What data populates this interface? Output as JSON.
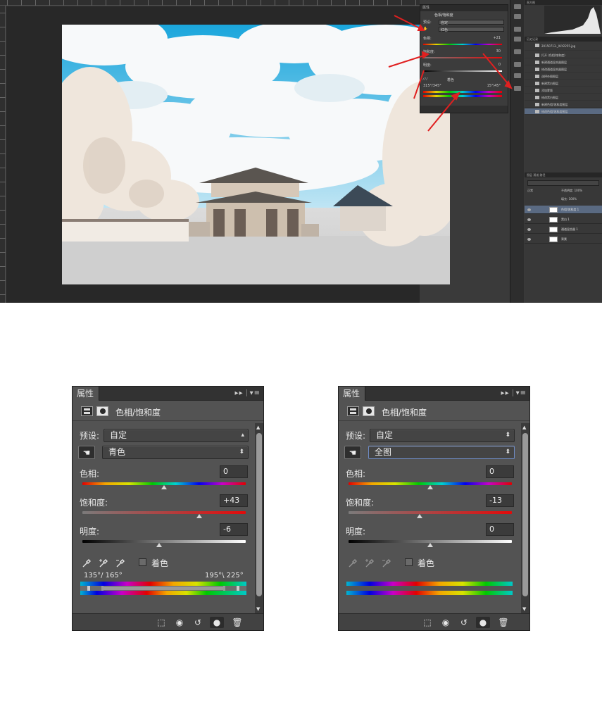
{
  "top": {
    "props_tab": "属性",
    "props_title": "色相/饱和度",
    "preset_label": "预设:",
    "preset_value": "自定",
    "channel_value": "红色",
    "hue_label": "色相:",
    "hue_value": "+21",
    "sat_label": "饱和度:",
    "sat_value": "30",
    "light_label": "明度:",
    "light_value": "0",
    "range_left": "315°/345°",
    "range_right": "15°\\45°",
    "colorize_label": "着色",
    "histo_tab": "直方图",
    "history_tabs": "历史记录",
    "history_doc": "20150713-_XLY2255.jpg",
    "history_items": [
      "打开 (色相/饱和度)",
      "新建通道混合器图层",
      "修改通道混合器图层",
      "选择杂图图层",
      "新建黑白图层",
      "添加蒙版",
      "修改黑白图层",
      "新建色相/饱和度图层",
      "修改色相/饱和度图层"
    ],
    "layers_tabs": "图层 通道 路径",
    "blend_mode": "正常",
    "opacity_label": "不透明度: 100%",
    "fill_label": "填充: 100%",
    "layers": [
      "色相/饱和度 1",
      "黑白 1",
      "通道混合器 1",
      "背景"
    ]
  },
  "left_panel": {
    "tab": "属性",
    "title": "色相/饱和度",
    "preset_label": "预设:",
    "preset_value": "自定",
    "channel_value": "青色",
    "hue_label": "色相:",
    "hue_value": "0",
    "hue_pos": 0.5,
    "sat_label": "饱和度:",
    "sat_value": "+43",
    "sat_pos": 0.715,
    "light_label": "明度:",
    "light_value": "-6",
    "light_pos": 0.47,
    "colorize_label": "着色",
    "range_left": "135°/ 165°",
    "range_right": "195°\\ 225°"
  },
  "right_panel": {
    "tab": "属性",
    "title": "色相/饱和度",
    "preset_label": "预设:",
    "preset_value": "自定",
    "channel_value": "全图",
    "hue_label": "色相:",
    "hue_value": "0",
    "hue_pos": 0.5,
    "sat_label": "饱和度:",
    "sat_value": "-13",
    "sat_pos": 0.435,
    "light_label": "明度:",
    "light_value": "0",
    "light_pos": 0.5,
    "colorize_label": "着色"
  },
  "colors": {
    "panel_bg": "#535353",
    "annotation_red": "#e02020",
    "sky_blue": "#2ab4e4"
  }
}
